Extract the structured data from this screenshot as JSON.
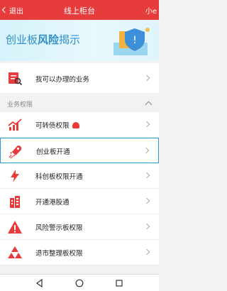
{
  "header": {
    "back_label": "退出",
    "title": "线上柜台",
    "right_text": "小e"
  },
  "banner": {
    "text_plain": "创业板",
    "text_bold": "风险",
    "text_tail": "揭示"
  },
  "top_card": {
    "label": "我可以办理的业务",
    "icon": "document-search-icon"
  },
  "section": {
    "label": "业务权限"
  },
  "items": [
    {
      "label": "可转债权限",
      "icon": "trend-chart-icon",
      "badge": true
    },
    {
      "label": "创业板开通",
      "icon": "rocket-icon",
      "selected": true
    },
    {
      "label": "科创板权限开通",
      "icon": "lightning-icon"
    },
    {
      "label": "开通港股通",
      "icon": "building-icon"
    },
    {
      "label": "风险警示板权限",
      "icon": "warning-icon"
    },
    {
      "label": "退市整理板权限",
      "icon": "stacked-triangles-icon"
    }
  ],
  "colors": {
    "brand_red": "#e63c3c",
    "banner_blue": "#2f90c9",
    "selection_blue": "#2d9bd1"
  }
}
